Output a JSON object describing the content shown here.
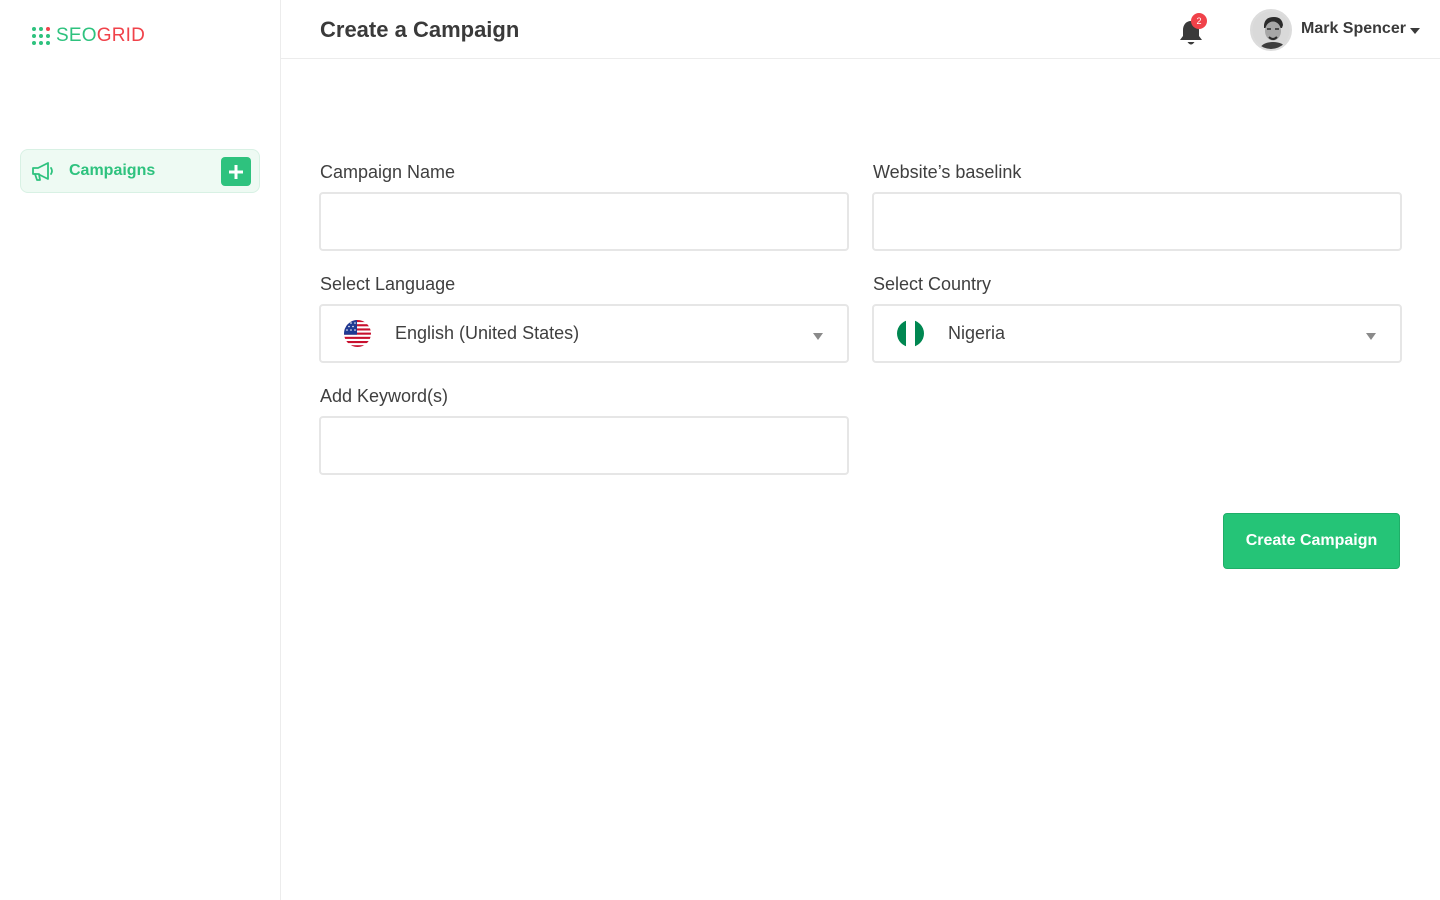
{
  "brand": {
    "part1": "SEO",
    "part2": "GRID",
    "colors": {
      "green": "#2ec27e",
      "red": "#f0424a"
    }
  },
  "sidebar": {
    "items": [
      {
        "label": "Campaigns",
        "icon": "megaphone-icon",
        "action_icon": "plus-icon"
      }
    ]
  },
  "header": {
    "title": "Create a Campaign",
    "notifications": {
      "count": "2",
      "icon": "bell-icon"
    },
    "user": {
      "name": "Mark Spencer",
      "icon": "avatar"
    }
  },
  "form": {
    "campaign_name": {
      "label": "Campaign Name",
      "value": "",
      "placeholder": ""
    },
    "website_baselink": {
      "label": "Website’s baselink",
      "value": "",
      "placeholder": ""
    },
    "language": {
      "label": "Select Language",
      "value": "English (United States)",
      "flag": "us-flag-icon"
    },
    "country": {
      "label": "Select Country",
      "value": "Nigeria",
      "flag": "nigeria-flag-icon"
    },
    "keywords": {
      "label": "Add Keyword(s)",
      "value": "",
      "placeholder": ""
    },
    "submit_label": "Create Campaign"
  },
  "colors": {
    "accent": "#25c477",
    "border": "#e6e6e6",
    "badge": "#f0424a"
  }
}
